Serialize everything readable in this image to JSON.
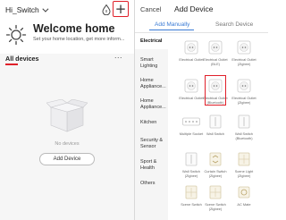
{
  "home": {
    "name": "Hi_Switch",
    "welcome_title": "Welcome home",
    "welcome_subtitle": "Set your home location, get more inform...",
    "devices_label": "All devices",
    "more": "...",
    "empty_text": "No devices",
    "add_button": "Add Device"
  },
  "add_device": {
    "cancel": "Cancel",
    "title": "Add Device",
    "tabs": [
      "Add Manually",
      "Search Device"
    ],
    "categories": [
      "Electrical",
      "Smart Lighting",
      "Home Appliance...",
      "Home Appliance...",
      "Kitchen",
      "Security & Sensor",
      "Sport & Health",
      "Others"
    ],
    "devices": [
      {
        "label": "Electrical Outlet",
        "icon": "outlet-icon"
      },
      {
        "label": "Electrical Outlet (BLE)",
        "icon": "outlet-icon"
      },
      {
        "label": "Electrical Outlet (Zigbee)",
        "icon": "outlet-icon"
      },
      {
        "label": "Electrical Outlet",
        "icon": "outlet-icon"
      },
      {
        "label": "Electrical Outlet (Bluetooth)",
        "icon": "outlet-icon"
      },
      {
        "label": "Electrical Outlet (Zigbee)",
        "icon": "outlet-icon"
      },
      {
        "label": "Multiple Socket",
        "icon": "power-strip-icon"
      },
      {
        "label": "Wall Switch",
        "icon": "wall-switch-icon"
      },
      {
        "label": "Wall Switch (Bluetooth)",
        "icon": "wall-switch-icon"
      },
      {
        "label": "Wall Switch (Zigbee)",
        "icon": "wall-switch-icon"
      },
      {
        "label": "Curtain Switch (Zigbee)",
        "icon": "curtain-switch-icon"
      },
      {
        "label": "Scene Light (Zigbee)",
        "icon": "scene-switch-icon"
      },
      {
        "label": "Scene Switch",
        "icon": "scene-switch-icon"
      },
      {
        "label": "Scene Switch (Zigbee)",
        "icon": "scene-switch-icon"
      },
      {
        "label": "AC Mate",
        "icon": "ac-mate-icon"
      }
    ]
  },
  "colors": {
    "accent_red": "#e0202a",
    "accent_blue": "#3a7bd5"
  }
}
